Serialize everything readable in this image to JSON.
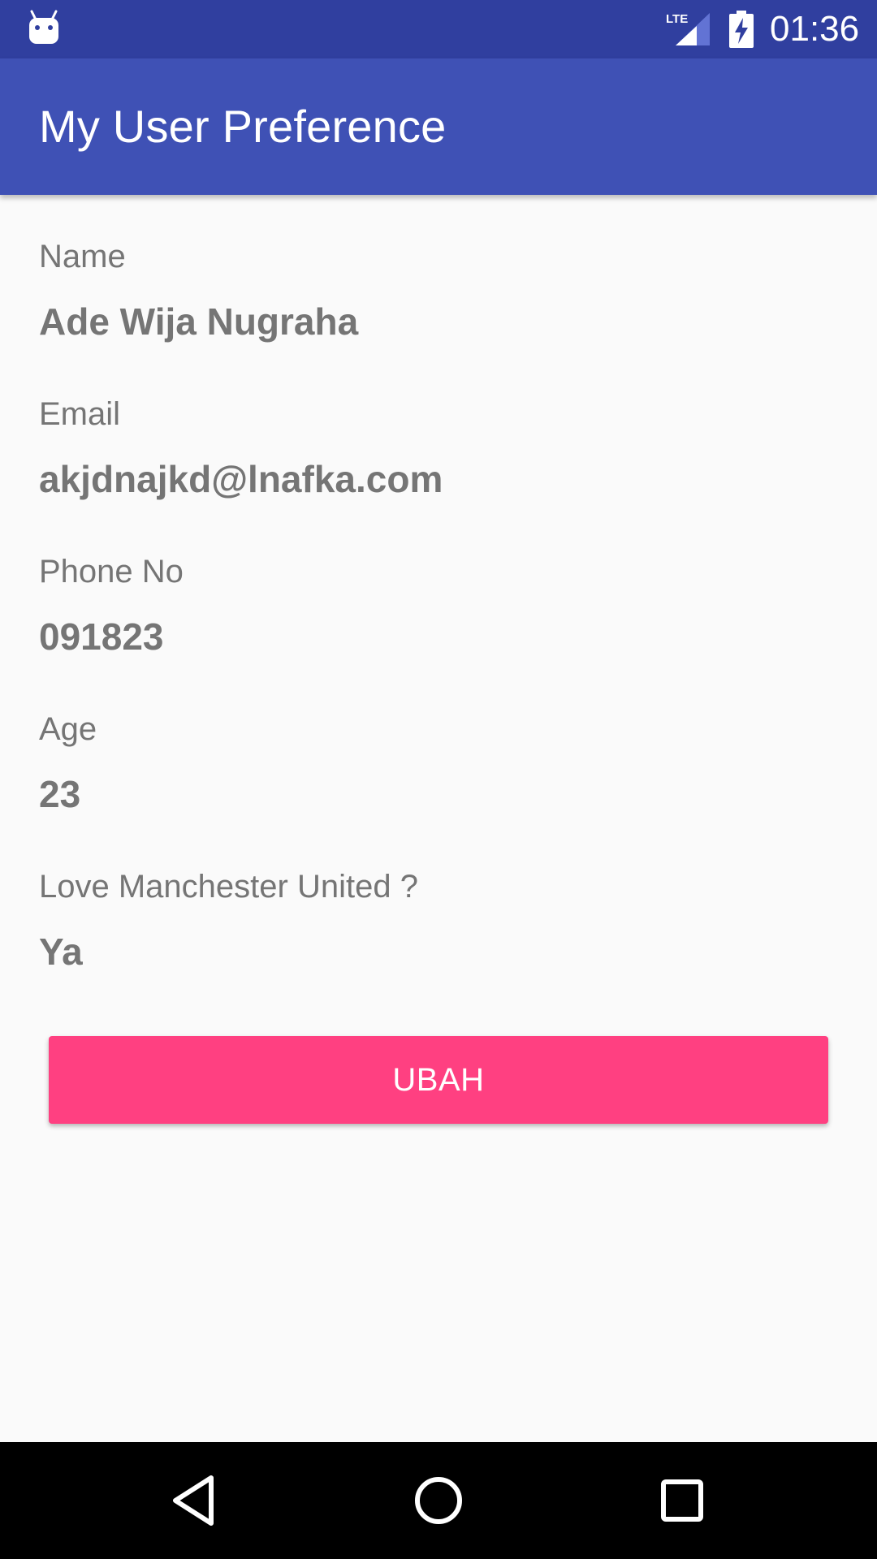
{
  "status_bar": {
    "time": "01:36",
    "icons": [
      "android-notification-icon",
      "lte-signal-icon",
      "battery-charging-icon"
    ]
  },
  "app_bar": {
    "title": "My User Preference"
  },
  "fields": [
    {
      "label": "Name",
      "value": "Ade Wija Nugraha"
    },
    {
      "label": "Email",
      "value": "akjdnajkd@lnafka.com"
    },
    {
      "label": "Phone No",
      "value": "091823"
    },
    {
      "label": "Age",
      "value": "23"
    },
    {
      "label": "Love Manchester United ?",
      "value": "Ya"
    }
  ],
  "action": {
    "button_label": "UBAH"
  },
  "colors": {
    "status_bar": "#303F9F",
    "primary": "#3F51B5",
    "accent": "#FF4081",
    "text_secondary": "#757575",
    "background": "#FAFAFA"
  },
  "nav_bar": {
    "icons": [
      "back-icon",
      "home-icon",
      "recents-icon"
    ]
  }
}
